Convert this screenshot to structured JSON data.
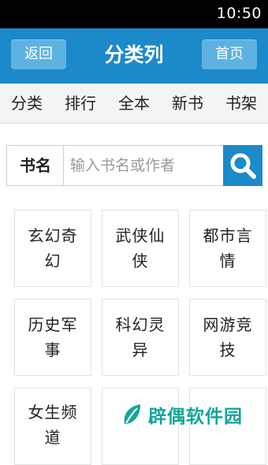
{
  "status_bar": {
    "time": "10:50"
  },
  "header": {
    "back_label": "返回",
    "title": "分类列",
    "home_label": "首页"
  },
  "nav": {
    "items": [
      {
        "label": "分类"
      },
      {
        "label": "排行"
      },
      {
        "label": "全本"
      },
      {
        "label": "新书"
      },
      {
        "label": "书架"
      }
    ]
  },
  "search": {
    "field_label": "书名",
    "placeholder": "输入书名或作者",
    "button_icon": "search-icon"
  },
  "categories": [
    {
      "label": "玄幻奇幻"
    },
    {
      "label": "武侠仙侠"
    },
    {
      "label": "都市言情"
    },
    {
      "label": "历史军事"
    },
    {
      "label": "科幻灵异"
    },
    {
      "label": "网游竞技"
    },
    {
      "label": "女生频道"
    },
    {
      "label": ""
    },
    {
      "label": ""
    }
  ],
  "watermark": {
    "text": "辟偶软件园",
    "icon": "leaf-logo"
  },
  "colors": {
    "header": "#1c89c9",
    "header_button": "#5eb2e2",
    "watermark": "#14a69a"
  }
}
